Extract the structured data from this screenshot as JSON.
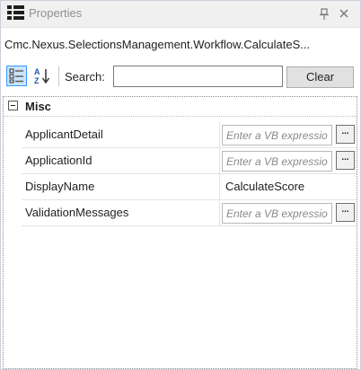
{
  "panel": {
    "title": "Properties",
    "object_name": "Cmc.Nexus.SelectionsManagement.Workflow.CalculateS..."
  },
  "toolbar": {
    "search_label": "Search:",
    "search_value": "",
    "clear_label": "Clear"
  },
  "grid": {
    "category": "Misc",
    "properties": [
      {
        "name": "ApplicantDetail",
        "value": "",
        "placeholder": "Enter a VB expression",
        "has_button": true
      },
      {
        "name": "ApplicationId",
        "value": "",
        "placeholder": "Enter a VB expression",
        "has_button": true
      },
      {
        "name": "DisplayName",
        "value": "CalculateScore",
        "placeholder": "",
        "has_button": false
      },
      {
        "name": "ValidationMessages",
        "value": "",
        "placeholder": "Enter a VB expression",
        "has_button": true
      }
    ],
    "ellipsis_label": "..."
  }
}
